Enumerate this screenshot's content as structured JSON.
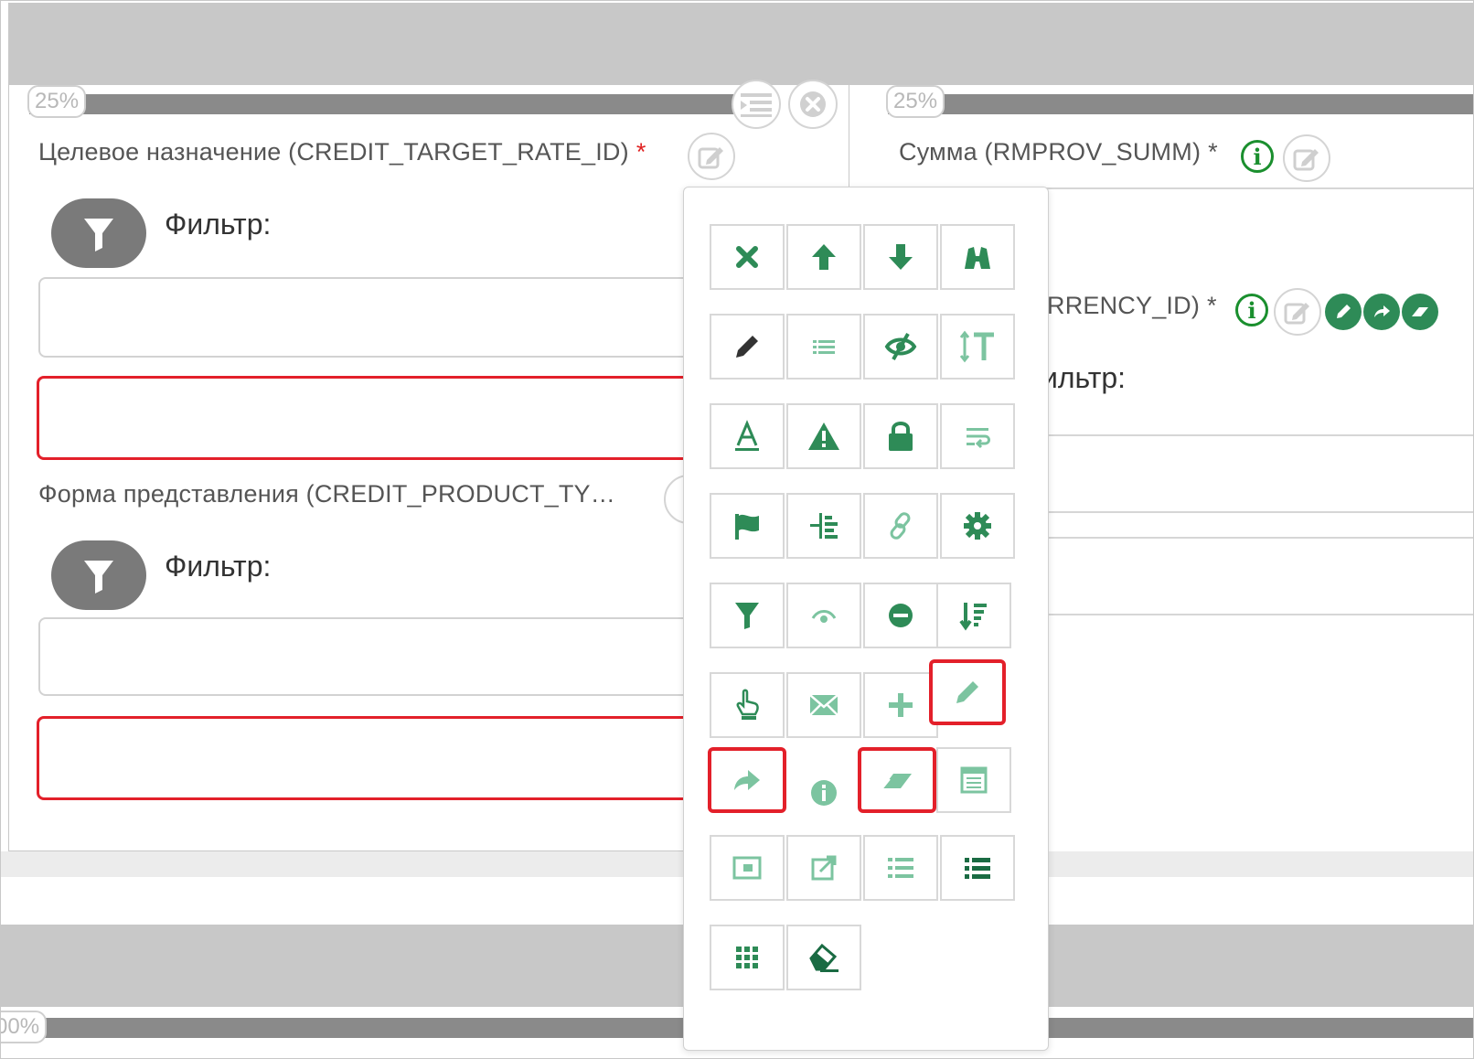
{
  "panels": {
    "left": {
      "progress": "25%",
      "field1": {
        "label": "Целевое назначение (CREDIT_TARGET_RATE_ID)",
        "required_mark": "*",
        "filter_label": "Фильтр:"
      },
      "field2": {
        "label": "Форма представления (CREDIT_PRODUCT_TY…",
        "filter_label": "Фильтр:"
      }
    },
    "right": {
      "progress": "25%",
      "field1": {
        "label": "Сумма (RMPROV_SUMM)",
        "required_mark": "*"
      },
      "field2": {
        "label": "RRENCY_ID)",
        "required_mark": "*",
        "filter_label": "ильтр:"
      }
    }
  },
  "bottom": {
    "progress": "00%"
  },
  "palette": {
    "accent_color": "#2e8b57",
    "light_color": "#7cc4a0",
    "highlight_color": "#e3202a",
    "rows": [
      [
        "close-icon",
        "arrow-up-icon",
        "arrow-down-icon",
        "binoculars-icon"
      ],
      [
        "pencil-icon",
        "list-icon",
        "eye-slash-icon",
        "text-height-icon"
      ],
      [
        "font-icon",
        "warning-icon",
        "lock-icon",
        "text-wrap-icon"
      ],
      [
        "flag-icon",
        "indent-icon",
        "link-icon",
        "gear-icon"
      ],
      [
        "filter-icon",
        "eye-icon",
        "minus-circle-icon",
        "sort-desc-icon"
      ],
      [
        "hand-pointer-icon",
        "envelope-icon",
        "plus-icon",
        "pencil-icon"
      ],
      [
        "share-icon",
        "info-icon",
        "eraser-icon",
        "table-icon"
      ],
      [
        "window-icon",
        "external-link-icon",
        "list-ul-icon",
        "list-bold-icon"
      ],
      [
        "grid-icon",
        "eraser-solid-icon"
      ]
    ]
  }
}
